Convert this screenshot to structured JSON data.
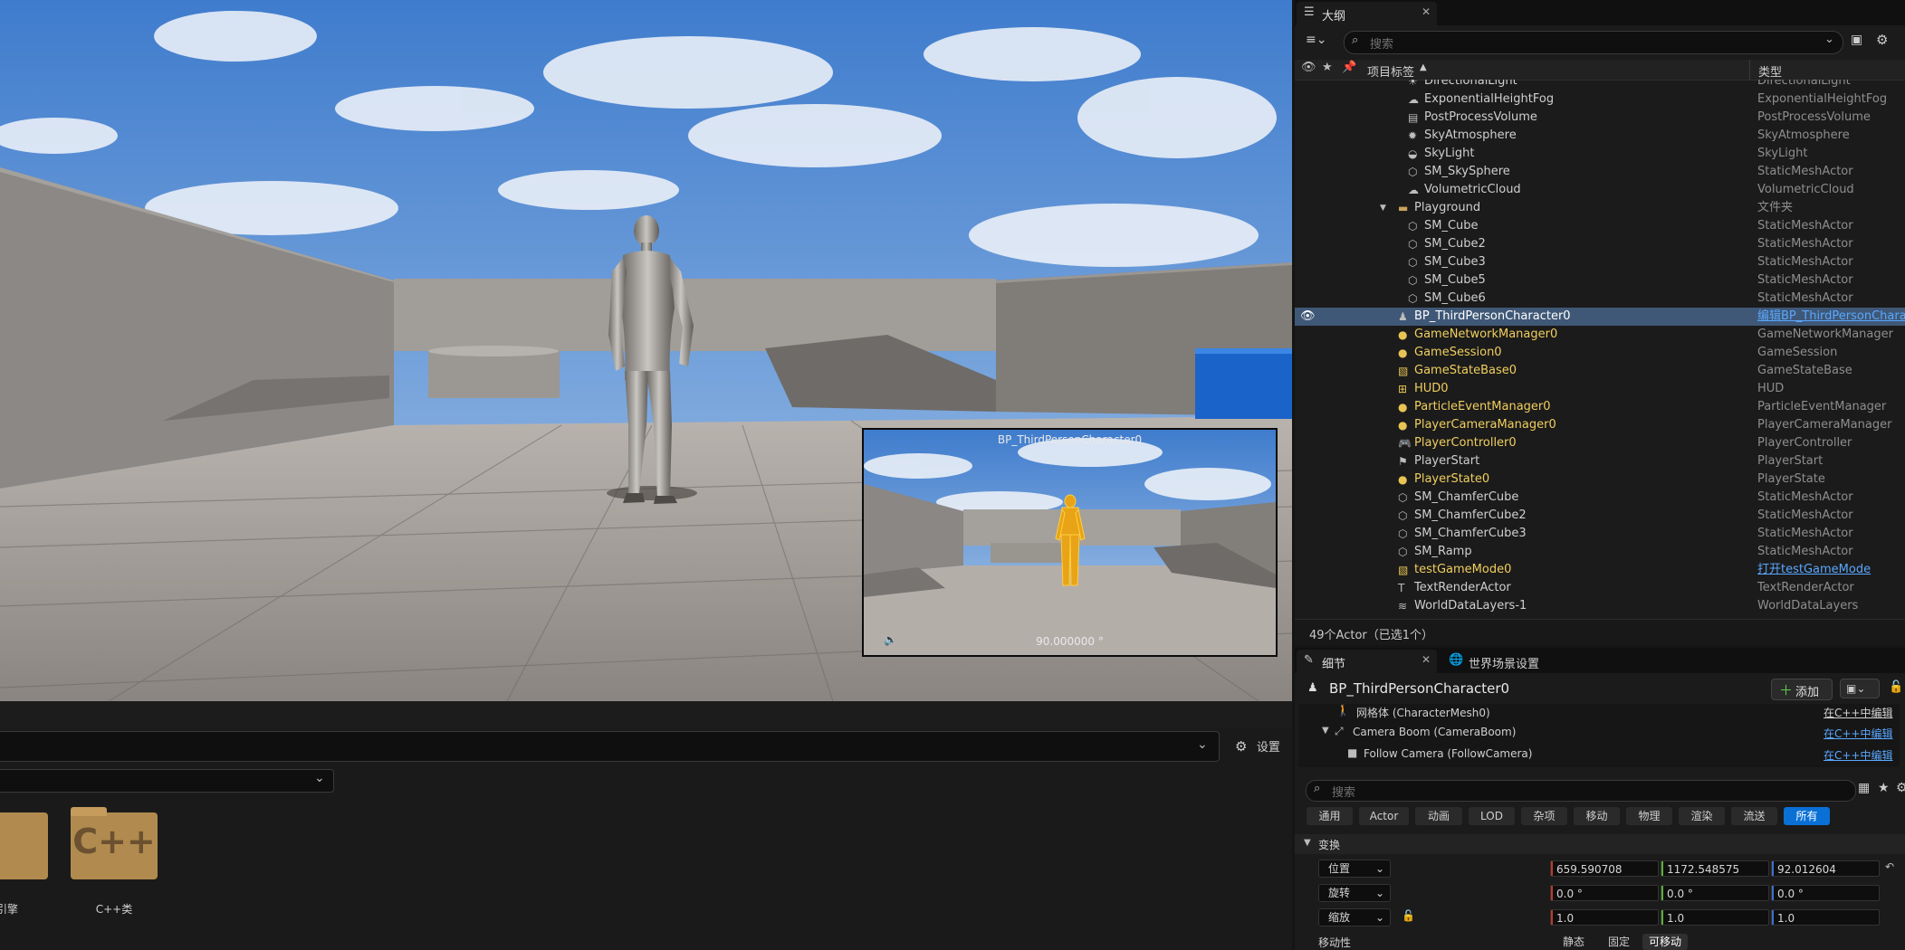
{
  "viewport": {
    "preview_title": "BP_ThirdPersonCharacter0",
    "preview_fov": "90.000000 °"
  },
  "content_browser": {
    "settings_label": "设置",
    "folders": [
      {
        "label": "引擎"
      },
      {
        "label": "C++类",
        "badge": "C++"
      }
    ]
  },
  "outliner": {
    "tab_label": "大纲",
    "search_placeholder": "搜索",
    "col_label": "项目标签",
    "col_type": "类型",
    "rows": [
      {
        "name": "DirectionalLight",
        "type": "DirectionalLight",
        "indent": 2,
        "icon": "light-icon"
      },
      {
        "name": "ExponentialHeightFog",
        "type": "ExponentialHeightFog",
        "indent": 2,
        "icon": "fog-icon"
      },
      {
        "name": "PostProcessVolume",
        "type": "PostProcessVolume",
        "indent": 2,
        "icon": "volume-icon"
      },
      {
        "name": "SkyAtmosphere",
        "type": "SkyAtmosphere",
        "indent": 2,
        "icon": "sun-icon"
      },
      {
        "name": "SkyLight",
        "type": "SkyLight",
        "indent": 2,
        "icon": "skylight-icon"
      },
      {
        "name": "SM_SkySphere",
        "type": "StaticMeshActor",
        "indent": 2,
        "icon": "mesh-icon"
      },
      {
        "name": "VolumetricCloud",
        "type": "VolumetricCloud",
        "indent": 2,
        "icon": "cloud-icon"
      },
      {
        "name": "Playground",
        "type": "文件夹",
        "indent": 1,
        "icon": "folder-icon",
        "expander": "▼"
      },
      {
        "name": "SM_Cube",
        "type": "StaticMeshActor",
        "indent": 2,
        "icon": "mesh-icon"
      },
      {
        "name": "SM_Cube2",
        "type": "StaticMeshActor",
        "indent": 2,
        "icon": "mesh-icon"
      },
      {
        "name": "SM_Cube3",
        "type": "StaticMeshActor",
        "indent": 2,
        "icon": "mesh-icon"
      },
      {
        "name": "SM_Cube5",
        "type": "StaticMeshActor",
        "indent": 2,
        "icon": "mesh-icon"
      },
      {
        "name": "SM_Cube6",
        "type": "StaticMeshActor",
        "indent": 2,
        "icon": "mesh-icon"
      },
      {
        "name": "BP_ThirdPersonCharacter0",
        "type": "编辑BP_ThirdPersonCharacter",
        "indent": 1,
        "icon": "pawn-icon",
        "selected": true
      },
      {
        "name": "GameNetworkManager0",
        "type": "GameNetworkManager",
        "indent": 1,
        "icon": "actor-icon",
        "yellow": true
      },
      {
        "name": "GameSession0",
        "type": "GameSession",
        "indent": 1,
        "icon": "actor-icon",
        "yellow": true
      },
      {
        "name": "GameStateBase0",
        "type": "GameStateBase",
        "indent": 1,
        "icon": "image-icon",
        "yellow": true
      },
      {
        "name": "HUD0",
        "type": "HUD",
        "indent": 1,
        "icon": "hud-icon",
        "yellow": true
      },
      {
        "name": "ParticleEventManager0",
        "type": "ParticleEventManager",
        "indent": 1,
        "icon": "actor-icon",
        "yellow": true
      },
      {
        "name": "PlayerCameraManager0",
        "type": "PlayerCameraManager",
        "indent": 1,
        "icon": "actor-icon",
        "yellow": true
      },
      {
        "name": "PlayerController0",
        "type": "PlayerController",
        "indent": 1,
        "icon": "gamepad-icon",
        "yellow": true
      },
      {
        "name": "PlayerStart",
        "type": "PlayerStart",
        "indent": 1,
        "icon": "flag-icon"
      },
      {
        "name": "PlayerState0",
        "type": "PlayerState",
        "indent": 1,
        "icon": "actor-icon",
        "yellow": true
      },
      {
        "name": "SM_ChamferCube",
        "type": "StaticMeshActor",
        "indent": 1,
        "icon": "mesh-icon"
      },
      {
        "name": "SM_ChamferCube2",
        "type": "StaticMeshActor",
        "indent": 1,
        "icon": "mesh-icon"
      },
      {
        "name": "SM_ChamferCube3",
        "type": "StaticMeshActor",
        "indent": 1,
        "icon": "mesh-icon"
      },
      {
        "name": "SM_Ramp",
        "type": "StaticMeshActor",
        "indent": 1,
        "icon": "mesh-icon"
      },
      {
        "name": "testGameMode0",
        "type": "打开testGameMode",
        "indent": 1,
        "icon": "image-icon",
        "yellow": true,
        "link": true
      },
      {
        "name": "TextRenderActor",
        "type": "TextRenderActor",
        "indent": 1,
        "icon": "text-icon"
      },
      {
        "name": "WorldDataLayers-1",
        "type": "WorldDataLayers",
        "indent": 1,
        "icon": "layers-icon"
      }
    ],
    "status": "49个Actor（已选1个）"
  },
  "details": {
    "tab_label": "细节",
    "tab2_label": "世界场景设置",
    "actor_name": "BP_ThirdPersonCharacter0",
    "add_label": "添加",
    "components": [
      {
        "name": "网格体 (CharacterMesh0)",
        "link": "在C++中编辑"
      },
      {
        "name": "Camera Boom (CameraBoom)",
        "link": "在C++中编辑"
      },
      {
        "name": "Follow Camera (FollowCamera)",
        "link": "在C++中编辑"
      }
    ],
    "search_placeholder": "搜索",
    "categories": [
      "通用",
      "Actor",
      "动画",
      "LOD",
      "杂项",
      "移动",
      "物理",
      "渲染",
      "流送",
      "所有"
    ],
    "active_category": "所有",
    "section_transform": "变换",
    "location": {
      "label": "位置",
      "x": "659.590708",
      "y": "1172.548575",
      "z": "92.012604"
    },
    "rotation": {
      "label": "旋转",
      "x": "0.0 °",
      "y": "0.0 °",
      "z": "0.0 °"
    },
    "scale": {
      "label": "缩放",
      "x": "1.0",
      "y": "1.0",
      "z": "1.0"
    },
    "mobility": {
      "label": "移动性",
      "options": [
        "静态",
        "固定",
        "可移动"
      ],
      "selected": "可移动"
    }
  },
  "colors": {
    "accent": "#0a70d6",
    "selection": "#3f5877",
    "actor_yellow": "#f0cf5e",
    "axis_x": "#c0392b",
    "axis_y": "#5bae3b",
    "axis_z": "#3a6fd0"
  }
}
